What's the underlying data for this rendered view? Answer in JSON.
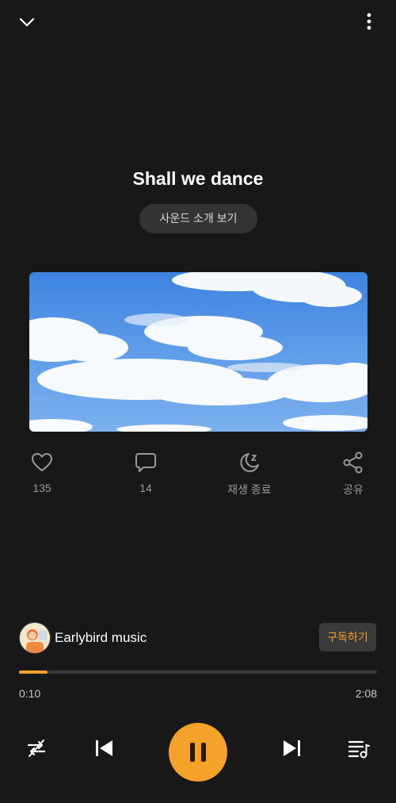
{
  "header": {
    "collapse_icon": "chevron-down-icon",
    "menu_icon": "more-vertical-icon"
  },
  "track": {
    "title": "Shall we dance",
    "intro_button": "사운드 소개 보기"
  },
  "actions": [
    {
      "icon": "heart-icon",
      "label": "135"
    },
    {
      "icon": "comment-icon",
      "label": "14"
    },
    {
      "icon": "sleep-timer-icon",
      "label": "재생 종료"
    },
    {
      "icon": "share-icon",
      "label": "공유"
    }
  ],
  "channel": {
    "name": "Earlybird music",
    "subscribe_label": "구독하기"
  },
  "player": {
    "current_time": "0:10",
    "total_time": "2:08",
    "progress": 0.08
  },
  "colors": {
    "accent": "#f5a22b",
    "background": "#181818"
  }
}
